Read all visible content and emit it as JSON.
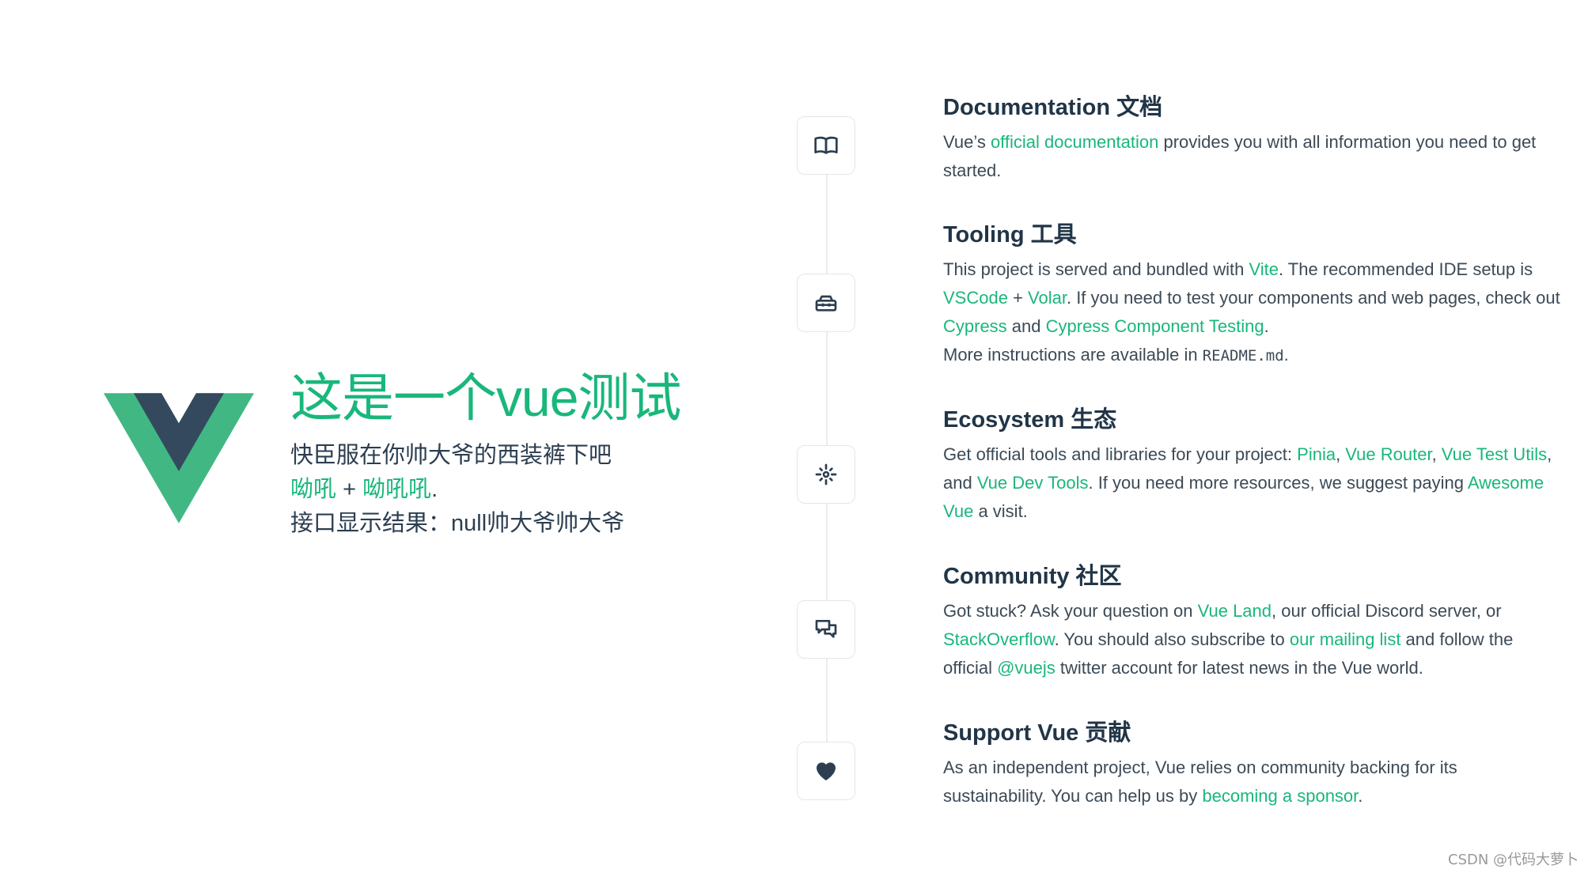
{
  "colors": {
    "accent": "#19b77b",
    "logo_green": "#41b883",
    "logo_dark": "#34495e",
    "text": "#2c3e50"
  },
  "hero": {
    "title": "这是一个vue测试",
    "subtitle": "快臣服在你帅大爷的西装裤下吧",
    "link1": "呦吼",
    "plus": " + ",
    "link2": "呦吼吼",
    "period": ".",
    "api_result": "接口显示结果：null帅大爷帅大爷"
  },
  "sections": {
    "docs": {
      "title": "Documentation 文档",
      "t1": "Vue’s ",
      "l1": "official documentation",
      "t2": " provides you with all information you need to get started."
    },
    "tooling": {
      "title": "Tooling 工具",
      "t1": "This project is served and bundled with ",
      "l1": "Vite",
      "t2": ". The recommended IDE setup is ",
      "l2": "VSCode",
      "t3": " + ",
      "l3": "Volar",
      "t4": ". If you need to test your components and web pages, check out ",
      "l4": "Cypress",
      "t5": " and ",
      "l5": "Cypress Component Testing",
      "t6": ".",
      "t7": "More instructions are available in ",
      "code": "README.md",
      "t8": "."
    },
    "ecosystem": {
      "title": "Ecosystem 生态",
      "t1": "Get official tools and libraries for your project: ",
      "l1": "Pinia",
      "t2": ", ",
      "l2": "Vue Router",
      "t3": ", ",
      "l3": "Vue Test Utils",
      "t4": ", and ",
      "l4": "Vue Dev Tools",
      "t5": ". If you need more resources, we suggest paying ",
      "l5": "Awesome Vue",
      "t6": " a visit."
    },
    "community": {
      "title": "Community 社区",
      "t1": "Got stuck? Ask your question on ",
      "l1": "Vue Land",
      "t2": ", our official Discord server, or ",
      "l2": "StackOverflow",
      "t3": ". You should also subscribe to ",
      "l3": "our mailing list",
      "t4": " and follow the official ",
      "l4": "@vuejs",
      "t5": " twitter account for latest news in the Vue world."
    },
    "support": {
      "title": "Support Vue 贡献",
      "t1": "As an independent project, Vue relies on community backing for its sustainability. You can help us by ",
      "l1": "becoming a sponsor",
      "t2": "."
    }
  },
  "icons": [
    "book-icon",
    "toolbox-icon",
    "ecosystem-icon",
    "chat-bubbles-icon",
    "heart-icon"
  ],
  "watermark": "CSDN @代码大萝卜"
}
